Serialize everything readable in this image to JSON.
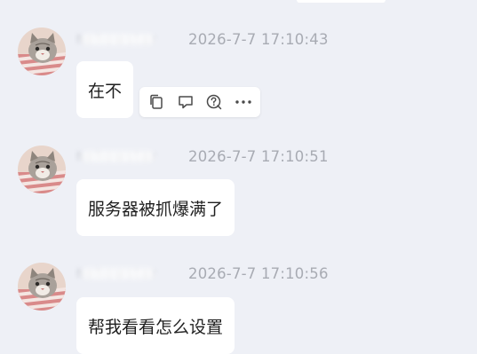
{
  "messages": [
    {
      "sender_name": "hehowstar",
      "timestamp": "2026-7-7  17:10:43",
      "text": "在不"
    },
    {
      "sender_name": "hehowstar",
      "timestamp": "2026-7-7  17:10:51",
      "text": "服务器被抓爆满了"
    },
    {
      "sender_name": "hehowstar",
      "timestamp": "2026-7-7  17:10:56",
      "text": "帮我看看怎么设置"
    }
  ],
  "toolbar": {
    "icons": [
      "copy-icon",
      "comment-icon",
      "question-icon",
      "more-icon"
    ]
  },
  "colors": {
    "background": "#eef0f6",
    "bubble": "#ffffff",
    "timestamp": "#a8abb3",
    "text": "#1f1f1f"
  }
}
